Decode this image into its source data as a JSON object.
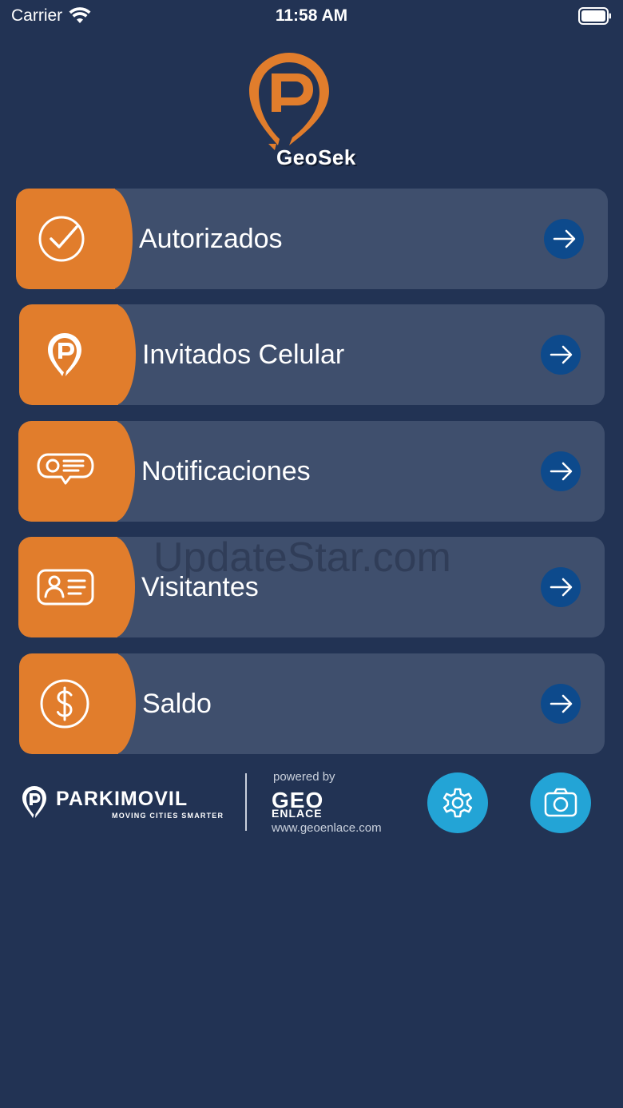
{
  "status_bar": {
    "carrier": "Carrier",
    "time": "11:58 AM"
  },
  "logo": {
    "brand": "GeoSek"
  },
  "menu": {
    "items": [
      {
        "label": "Autorizados",
        "icon": "check-circle-icon"
      },
      {
        "label": "Invitados Celular",
        "icon": "parking-pin-icon"
      },
      {
        "label": "Notificaciones",
        "icon": "message-bubble-icon"
      },
      {
        "label": "Visitantes",
        "icon": "id-card-icon"
      },
      {
        "label": "Saldo",
        "icon": "dollar-coin-icon"
      }
    ]
  },
  "footer": {
    "parkimovil_name": "PARKIMOVIL",
    "parkimovil_tagline": "MOVING CITIES SMARTER",
    "powered_by": "powered by",
    "geo": "GEO",
    "enlace": "ENLACE",
    "url": "www.geoenlace.com",
    "settings_icon": "gear-icon",
    "camera_icon": "camera-icon"
  },
  "watermark": "UpdateStar.com",
  "colors": {
    "background": "#223354",
    "card": "#3f4f6d",
    "accent_orange": "#e17d2c",
    "arrow_blue": "#0d4a8c",
    "button_cyan": "#23a4d6"
  }
}
